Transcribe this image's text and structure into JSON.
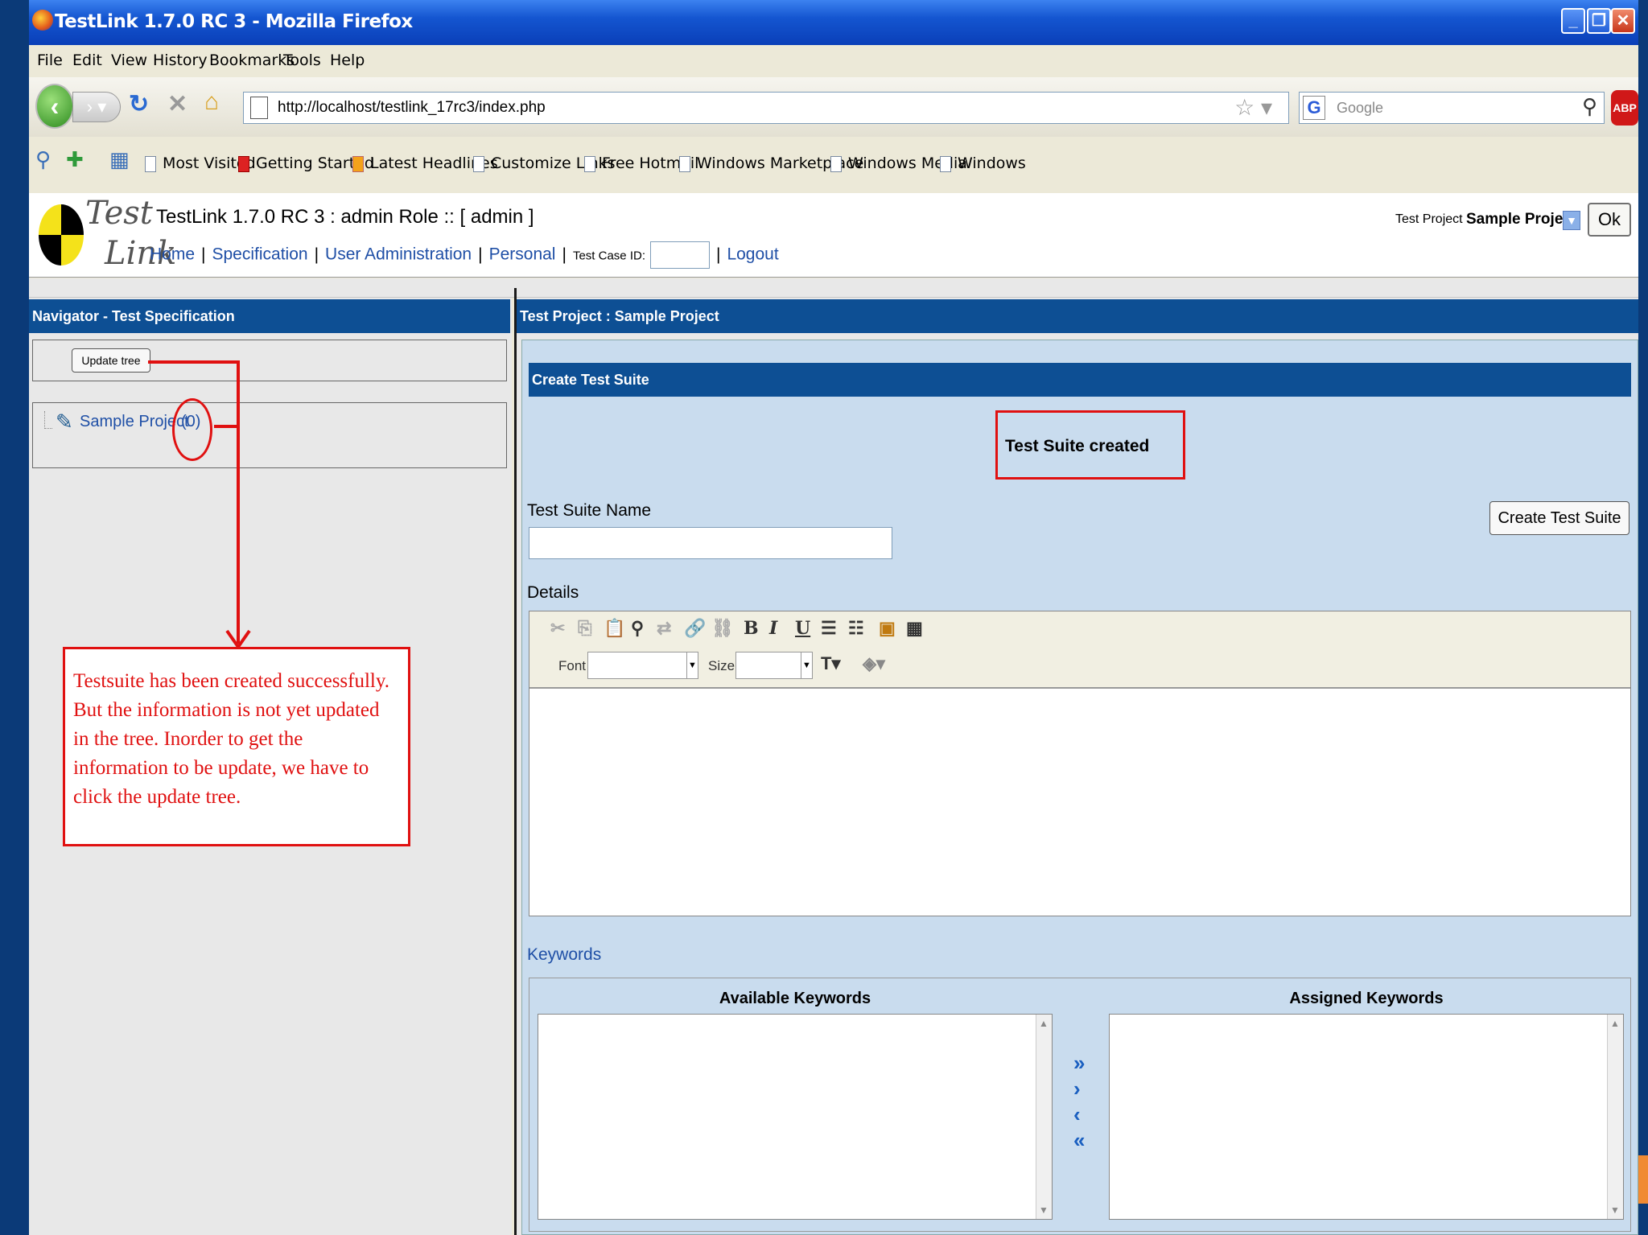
{
  "window": {
    "title": "TestLink 1.7.0 RC 3 - Mozilla Firefox"
  },
  "menu": [
    "File",
    "Edit",
    "View",
    "History",
    "Bookmarks",
    "Tools",
    "Help"
  ],
  "navbar": {
    "url": "http://localhost/testlink_17rc3/index.php",
    "search_placeholder": "Google",
    "search_engine": "G",
    "adblock": "ABP"
  },
  "bookmarks": [
    "Most Visited",
    "Getting Started",
    "Latest Headlines",
    "Customize Links",
    "Free Hotmail",
    "Windows Marketplace",
    "Windows Media",
    "Windows"
  ],
  "app": {
    "logo_top": "Test",
    "logo_bottom": "Link",
    "title": "TestLink 1.7.0 RC 3 : admin Role :: [ admin ]",
    "project_label": "Test Project",
    "project_value": "Sample Project",
    "ok": "Ok",
    "nav": {
      "home": "Home",
      "specification": "Specification",
      "user_admin": "User Administration",
      "personal": "Personal",
      "tcid_label": "Test Case ID:",
      "logout": "Logout"
    }
  },
  "left": {
    "header": "Navigator - Test Specification",
    "update_tree": "Update tree",
    "tree_item": "Sample Project",
    "tree_count": "(0)"
  },
  "right": {
    "header": "Test Project : Sample Project",
    "section": "Create Test Suite",
    "message": "Test Suite created",
    "name_label": "Test Suite Name",
    "create_button": "Create Test Suite",
    "details_label": "Details",
    "font_label": "Font",
    "size_label": "Size",
    "keywords_label": "Keywords",
    "available_keywords": "Available Keywords",
    "assigned_keywords": "Assigned Keywords"
  },
  "annotation": {
    "callout": "Testsuite has been created successfully. But the information is not yet updated in the tree. Inorder to get the information to be update, we have to click the update tree."
  },
  "colors": {
    "accent": "#0d4f94",
    "annotation": "#e01010",
    "link": "#1f4fa6"
  }
}
